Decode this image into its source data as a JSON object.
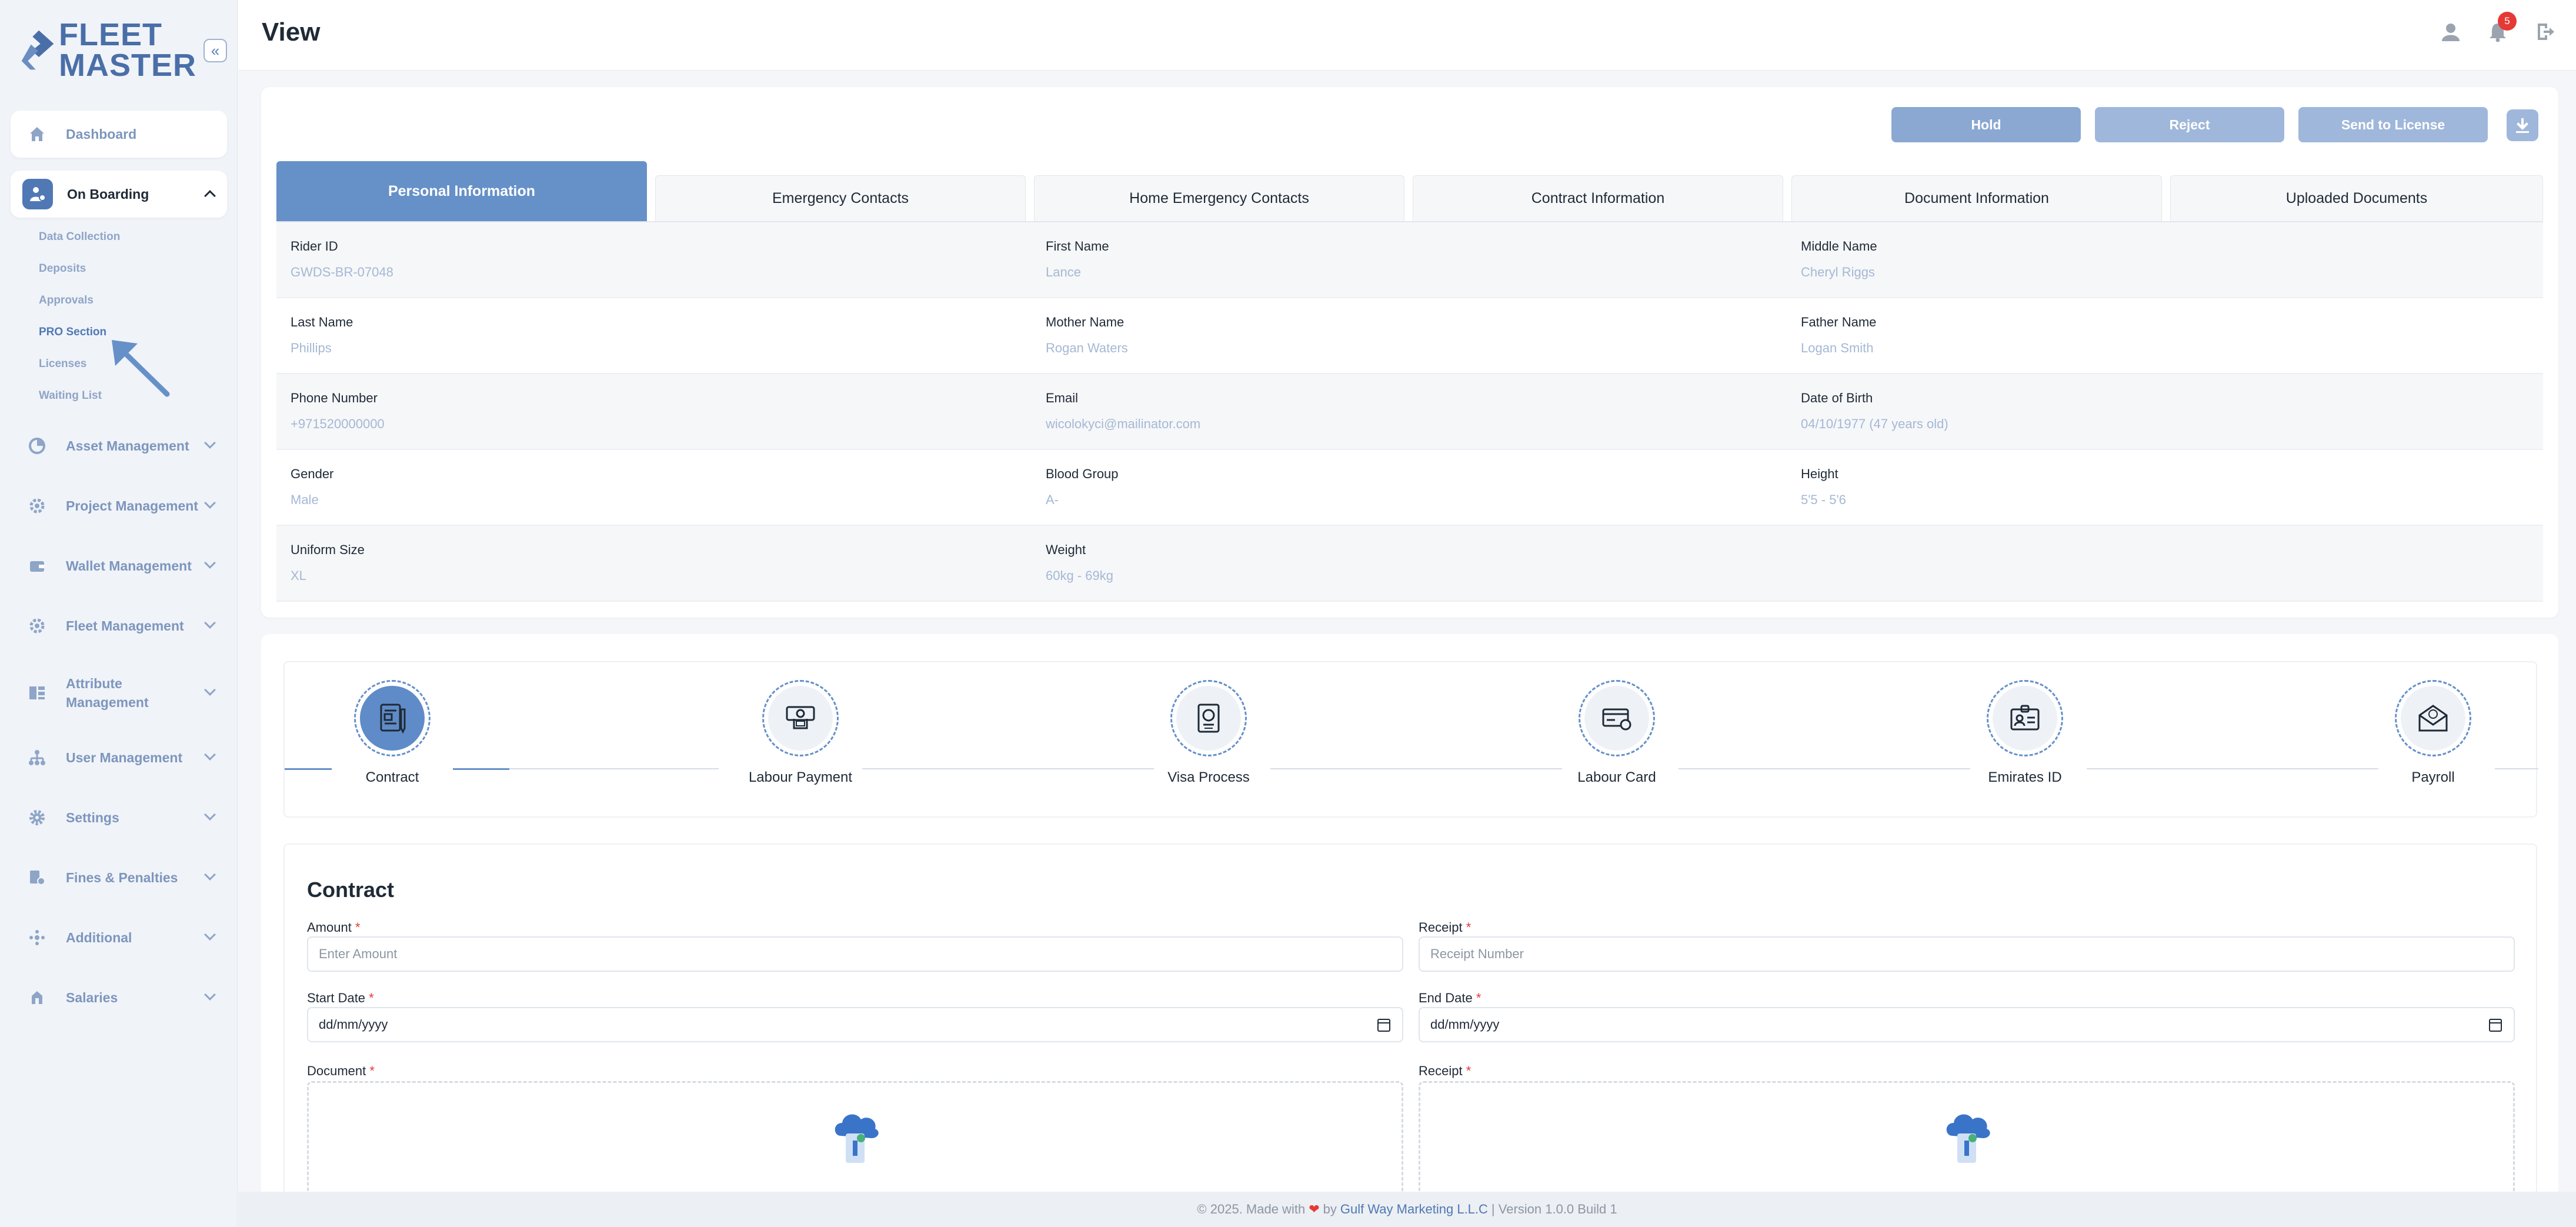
{
  "brand": {
    "line1": "FLEET",
    "line2": "MASTER",
    "collapse_icon": "double-chevron-left-icon"
  },
  "sidebar": {
    "dashboard": "Dashboard",
    "onboarding": "On Boarding",
    "onboarding_sub": [
      "Data Collection",
      "Deposits",
      "Approvals",
      "PRO Section",
      "Licenses",
      "Waiting List"
    ],
    "sections": [
      "Asset Management",
      "Project Management",
      "Wallet Management",
      "Fleet Management",
      "Attribute Management",
      "User Management",
      "Settings",
      "Fines & Penalties",
      "Additional",
      "Salaries"
    ]
  },
  "header": {
    "title": "View",
    "notifications_count": "5"
  },
  "actions": {
    "hold": "Hold",
    "reject": "Reject",
    "send": "Send to License"
  },
  "tabs": [
    "Personal Information",
    "Emergency Contacts",
    "Home Emergency Contacts",
    "Contract Information",
    "Document Information",
    "Uploaded Documents"
  ],
  "personal": {
    "rider_id": {
      "label": "Rider ID",
      "value": "GWDS-BR-07048"
    },
    "first_name": {
      "label": "First Name",
      "value": "Lance"
    },
    "middle_name": {
      "label": "Middle Name",
      "value": "Cheryl Riggs"
    },
    "last_name": {
      "label": "Last Name",
      "value": "Phillips"
    },
    "mother_name": {
      "label": "Mother Name",
      "value": "Rogan Waters"
    },
    "father_name": {
      "label": "Father Name",
      "value": "Logan Smith"
    },
    "phone": {
      "label": "Phone Number",
      "value": "+971520000000"
    },
    "email": {
      "label": "Email",
      "value": "wicolokyci@mailinator.com"
    },
    "dob": {
      "label": "Date of Birth",
      "value": "04/10/1977 (47 years old)"
    },
    "gender": {
      "label": "Gender",
      "value": "Male"
    },
    "blood": {
      "label": "Blood Group",
      "value": "A-"
    },
    "height": {
      "label": "Height",
      "value": "5'5 - 5'6"
    },
    "uniform": {
      "label": "Uniform Size",
      "value": "XL"
    },
    "weight": {
      "label": "Weight",
      "value": "60kg - 69kg"
    }
  },
  "steps": [
    "Contract",
    "Labour Payment",
    "Visa Process",
    "Labour Card",
    "Emirates ID",
    "Payroll"
  ],
  "form": {
    "title": "Contract",
    "amount_label": "Amount",
    "amount_placeholder": "Enter Amount",
    "receipt_label": "Receipt",
    "receipt_placeholder": "Receipt Number",
    "start_label": "Start Date",
    "end_label": "End Date",
    "date_placeholder": "dd/mm/yyyy",
    "document_label": "Document",
    "receipt2_label": "Receipt",
    "required_mark": "*"
  },
  "footer": {
    "prefix": "© 2025. Made with",
    "by": "by",
    "company": "Gulf Way Marketing L.L.C",
    "version": "| Version 1.0.0 Build 1"
  },
  "colors": {
    "accent": "#6690c8",
    "sidebar_text": "#7d96bd",
    "required": "#e53935"
  }
}
